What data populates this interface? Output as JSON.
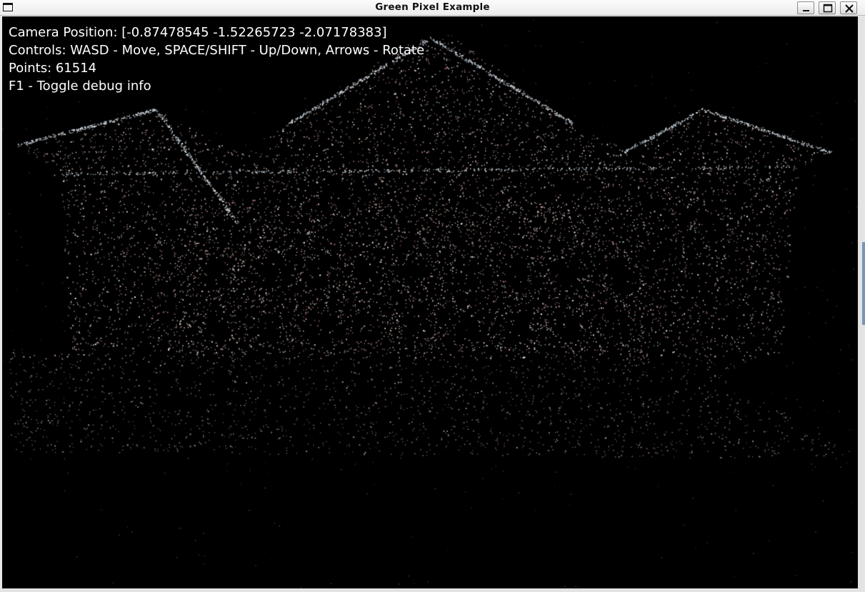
{
  "window": {
    "title": "Green Pixel Example",
    "controls": {
      "minimize_icon": "minimize-icon",
      "maximize_icon": "maximize-icon",
      "close_icon": "close-icon"
    }
  },
  "viewport": {
    "background": "#000000",
    "scene": "point-cloud-building-facade",
    "hud": {
      "camera_position": "Camera Position: [-0.87478545 -1.52265723 -2.07178383]",
      "controls": "Controls: WASD - Move, SPACE/SHIFT - Up/Down, Arrows - Rotate",
      "points": "Points: 61514",
      "debug_toggle": "F1 - Toggle debug info"
    }
  },
  "colors": {
    "hud_text": "#ffffff",
    "point_warm": "#d8b0a6",
    "point_cool": "#c8d8e8",
    "point_green": "#7fa07a"
  }
}
